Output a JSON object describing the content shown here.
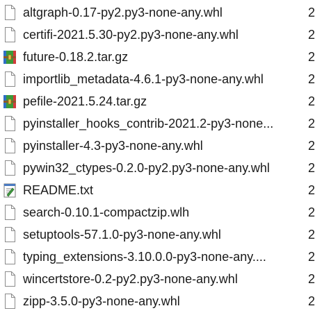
{
  "files": [
    {
      "name": "altgraph-0.17-py2.py3-none-any.whl",
      "date_fragment": "2",
      "icon": "blank-file-icon"
    },
    {
      "name": "certifi-2021.5.30-py2.py3-none-any.whl",
      "date_fragment": "2",
      "icon": "blank-file-icon"
    },
    {
      "name": "future-0.18.2.tar.gz",
      "date_fragment": "2",
      "icon": "archive-icon"
    },
    {
      "name": "importlib_metadata-4.6.1-py3-none-any.whl",
      "date_fragment": "2",
      "icon": "blank-file-icon"
    },
    {
      "name": "pefile-2021.5.24.tar.gz",
      "date_fragment": "2",
      "icon": "archive-icon"
    },
    {
      "name": "pyinstaller_hooks_contrib-2021.2-py3-none...",
      "date_fragment": "2",
      "icon": "blank-file-icon"
    },
    {
      "name": "pyinstaller-4.3-py3-none-any.whl",
      "date_fragment": "2",
      "icon": "blank-file-icon"
    },
    {
      "name": "pywin32_ctypes-0.2.0-py2.py3-none-any.whl",
      "date_fragment": "2",
      "icon": "blank-file-icon"
    },
    {
      "name": "README.txt",
      "date_fragment": "2",
      "icon": "text-file-icon"
    },
    {
      "name": "search-0.10.1-compactzip.wlh",
      "date_fragment": "2",
      "icon": "blank-file-icon"
    },
    {
      "name": "setuptools-57.1.0-py3-none-any.whl",
      "date_fragment": "2",
      "icon": "blank-file-icon"
    },
    {
      "name": "typing_extensions-3.10.0.0-py3-none-any....",
      "date_fragment": "2",
      "icon": "blank-file-icon"
    },
    {
      "name": "wincertstore-0.2-py2.py3-none-any.whl",
      "date_fragment": "2",
      "icon": "blank-file-icon"
    },
    {
      "name": "zipp-3.5.0-py3-none-any.whl",
      "date_fragment": "2",
      "icon": "blank-file-icon"
    }
  ]
}
